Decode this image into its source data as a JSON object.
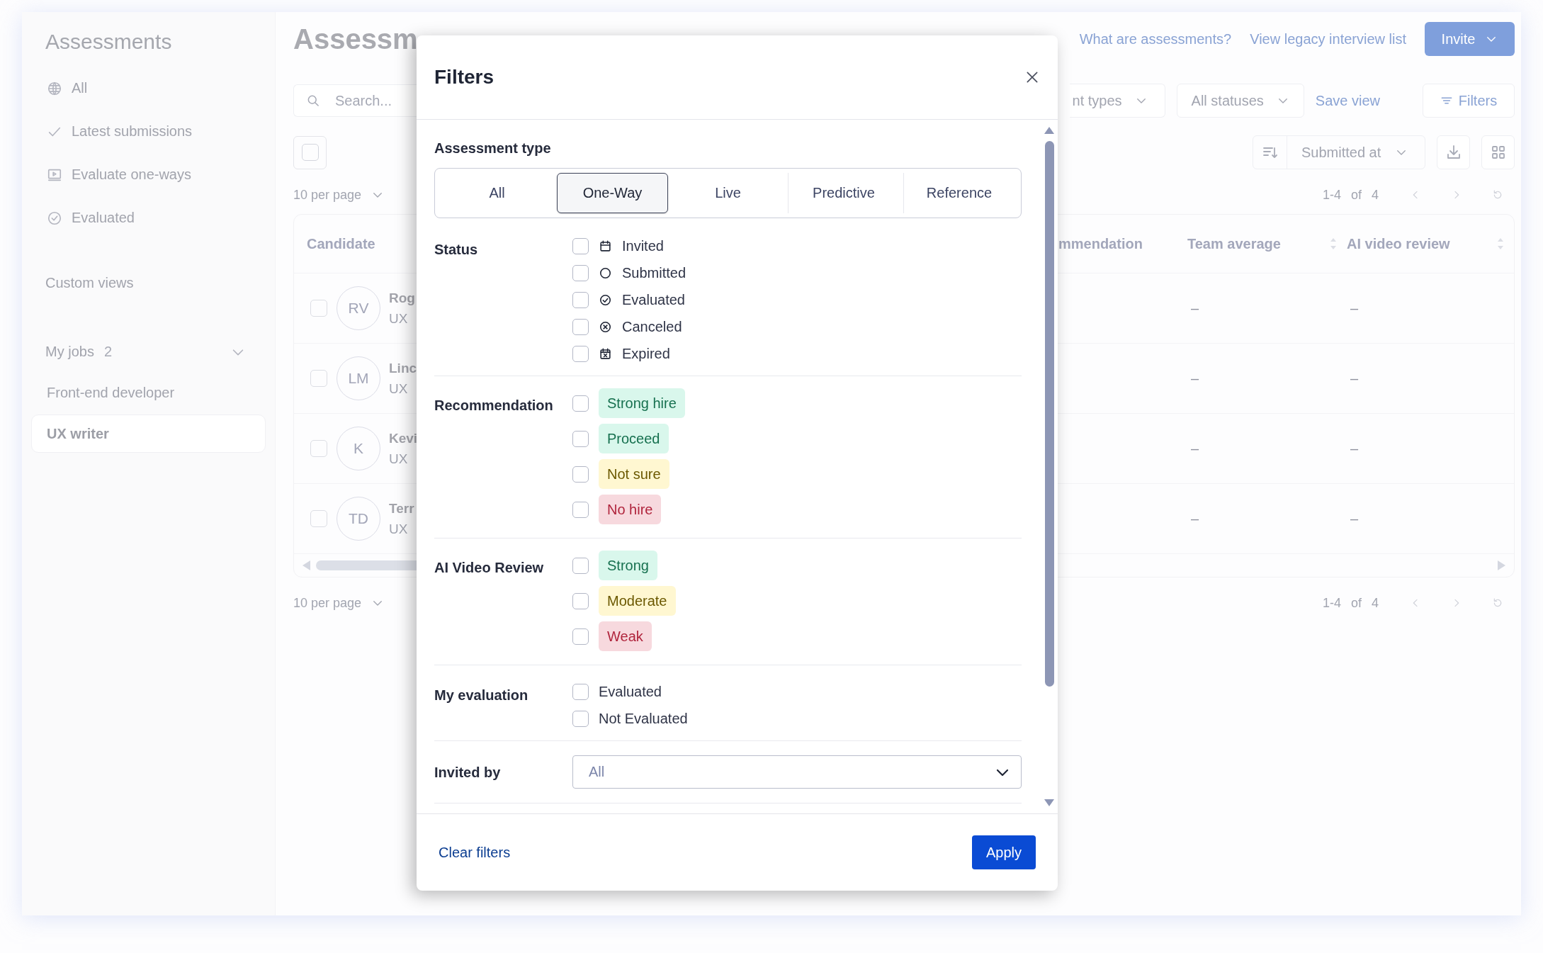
{
  "sidebar": {
    "title": "Assessments",
    "nav_items": [
      {
        "label": "All"
      },
      {
        "label": "Latest submissions"
      },
      {
        "label": "Evaluate one-ways"
      },
      {
        "label": "Evaluated"
      }
    ],
    "custom_views": "Custom views",
    "my_jobs": {
      "label": "My jobs",
      "count": "2",
      "items": [
        {
          "label": "Front-end developer",
          "selected": false
        },
        {
          "label": "UX writer",
          "selected": true
        }
      ]
    }
  },
  "main": {
    "title": "Assessm",
    "links": [
      "What are assessments?",
      "View legacy interview list"
    ],
    "invite_button": "Invite",
    "search": {
      "placeholder": "Search..."
    },
    "type_dropdown": "nt types",
    "status_dropdown": "All statuses",
    "save_view": "Save view",
    "filters_button": "Filters",
    "sort_dropdown": "Submitted at",
    "select_all": {
      "checked": false
    },
    "pagination_top": {
      "per_page": "10 per page",
      "range": "1-4",
      "of": "of",
      "total": "4"
    },
    "table": {
      "columns": [
        "Candidate",
        "mmendation",
        "Team average",
        "AI video review"
      ],
      "rows": [
        {
          "checked": false,
          "initials": "RV",
          "name": "Rog",
          "job": "UX",
          "team_average": "–",
          "ai_video_review": "–"
        },
        {
          "checked": false,
          "initials": "LM",
          "name": "Linc",
          "job": "UX",
          "team_average": "–",
          "ai_video_review": "–"
        },
        {
          "checked": false,
          "initials": "K",
          "name": "Kevi",
          "job": "UX",
          "team_average": "–",
          "ai_video_review": "–"
        },
        {
          "checked": false,
          "initials": "TD",
          "name": "Terr",
          "job": "UX",
          "team_average": "–",
          "ai_video_review": "–"
        }
      ]
    },
    "pagination_bottom": {
      "per_page": "10 per page",
      "range": "1-4",
      "of": "of",
      "total": "4"
    }
  },
  "filters_dialog": {
    "title": "Filters",
    "sections": [
      {
        "kind": "segmented",
        "label": "Assessment type",
        "options": [
          {
            "label": "All",
            "selected": false
          },
          {
            "label": "One-Way",
            "selected": true
          },
          {
            "label": "Live",
            "selected": false
          },
          {
            "label": "Predictive",
            "selected": false
          },
          {
            "label": "Reference",
            "selected": false
          }
        ]
      },
      {
        "kind": "status",
        "label": "Status",
        "options": [
          {
            "label": "Invited",
            "checked": false
          },
          {
            "label": "Submitted",
            "checked": false
          },
          {
            "label": "Evaluated",
            "checked": false
          },
          {
            "label": "Canceled",
            "checked": false
          },
          {
            "label": "Expired",
            "checked": false
          }
        ]
      },
      {
        "kind": "tags",
        "label": "Recommendation",
        "options": [
          {
            "label": "Strong hire",
            "checked": false,
            "color": "#16704f"
          },
          {
            "label": "Proceed",
            "checked": false,
            "color": "#16704f"
          },
          {
            "label": "Not sure",
            "checked": false,
            "color": "#6b5800"
          },
          {
            "label": "No hire",
            "checked": false,
            "color": "#b0243c"
          }
        ]
      },
      {
        "kind": "tags",
        "label": "AI Video Review",
        "options": [
          {
            "label": "Strong",
            "checked": false,
            "color": "#16704f"
          },
          {
            "label": "Moderate",
            "checked": false,
            "color": "#6b5800"
          },
          {
            "label": "Weak",
            "checked": false,
            "color": "#b0243c"
          }
        ]
      },
      {
        "kind": "plain",
        "label": "My evaluation",
        "options": [
          {
            "label": "Evaluated",
            "checked": false
          },
          {
            "label": "Not Evaluated",
            "checked": false
          }
        ]
      },
      {
        "kind": "select",
        "label": "Invited by",
        "value": "All"
      }
    ],
    "clear_button": "Clear filters",
    "apply_button": "Apply"
  }
}
